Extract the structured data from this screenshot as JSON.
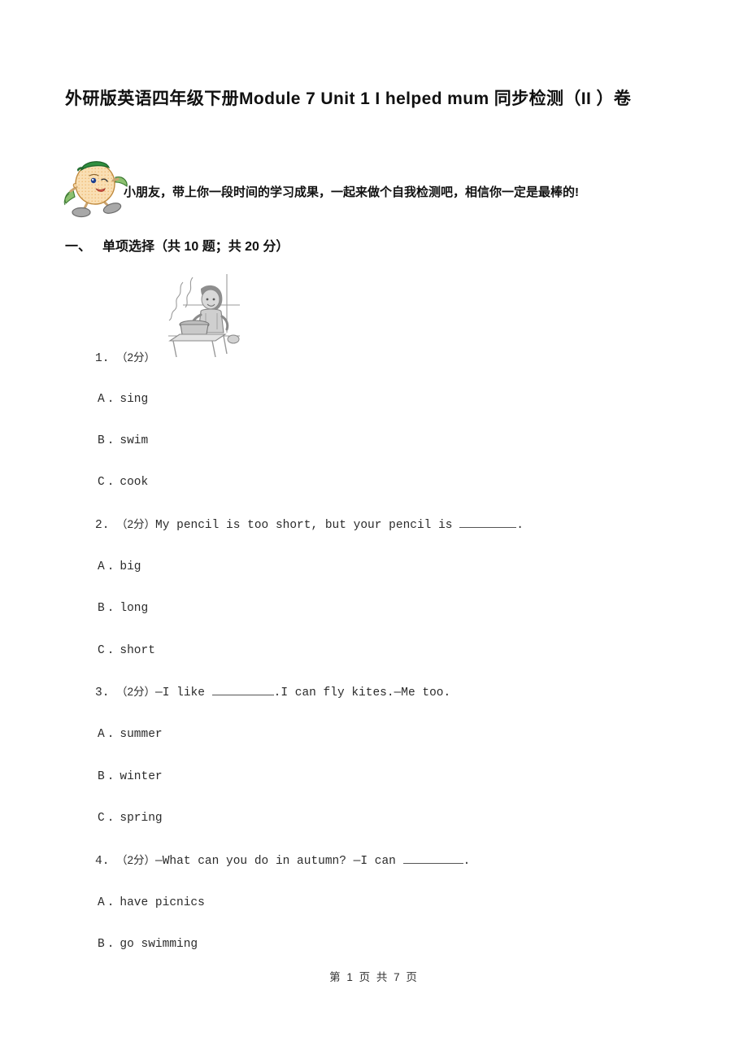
{
  "document": {
    "title": "外研版英语四年级下册Module 7 Unit 1 I helped mum 同步检测（II ）卷",
    "instruction": "小朋友，带上你一段时间的学习成果，一起来做个自我检测吧，相信你一定是最棒的!",
    "mascot_icon": "cartoon-mascot-icon",
    "footer": "第 1 页 共 7 页"
  },
  "section": {
    "number": "一、",
    "title": "单项选择（共 10 题；共 20 分）"
  },
  "questions": [
    {
      "number": "1.",
      "score": "（2分）",
      "text": "",
      "figure": "girl-cooking-illustration",
      "options": [
        {
          "key": "A",
          "dot": ".",
          "label": "sing"
        },
        {
          "key": "B",
          "dot": ".",
          "label": "swim"
        },
        {
          "key": "C",
          "dot": ".",
          "label": "cook"
        }
      ]
    },
    {
      "number": "2.",
      "score": "（2分）",
      "text_before": "My pencil is too short, but your pencil is ",
      "text_after": ".",
      "options": [
        {
          "key": "A",
          "dot": ".",
          "label": "big"
        },
        {
          "key": "B",
          "dot": ".",
          "label": "long"
        },
        {
          "key": "C",
          "dot": ".",
          "label": "short"
        }
      ]
    },
    {
      "number": "3.",
      "score": "（2分）",
      "text_before": "—I like ",
      "text_after": ".I can fly kites.—Me too.",
      "options": [
        {
          "key": "A",
          "dot": ".",
          "label": "summer"
        },
        {
          "key": "B",
          "dot": ".",
          "label": "winter"
        },
        {
          "key": "C",
          "dot": ".",
          "label": "spring"
        }
      ]
    },
    {
      "number": "4.",
      "score": "（2分）",
      "text_before": "—What can you do in autumn? —I can ",
      "text_after": ".",
      "options": [
        {
          "key": "A",
          "dot": ".",
          "label": "have picnics"
        },
        {
          "key": "B",
          "dot": ".",
          "label": "go swimming"
        }
      ]
    }
  ],
  "colors": {
    "page_background": "#ffffff",
    "text": "#111111",
    "body_text": "#2b2b2b",
    "mascot_body": "#f7d9a8",
    "mascot_cap": "#2f8f3f",
    "mascot_leaf": "#7fbf6a",
    "mascot_shoe": "#9a9a9a"
  }
}
